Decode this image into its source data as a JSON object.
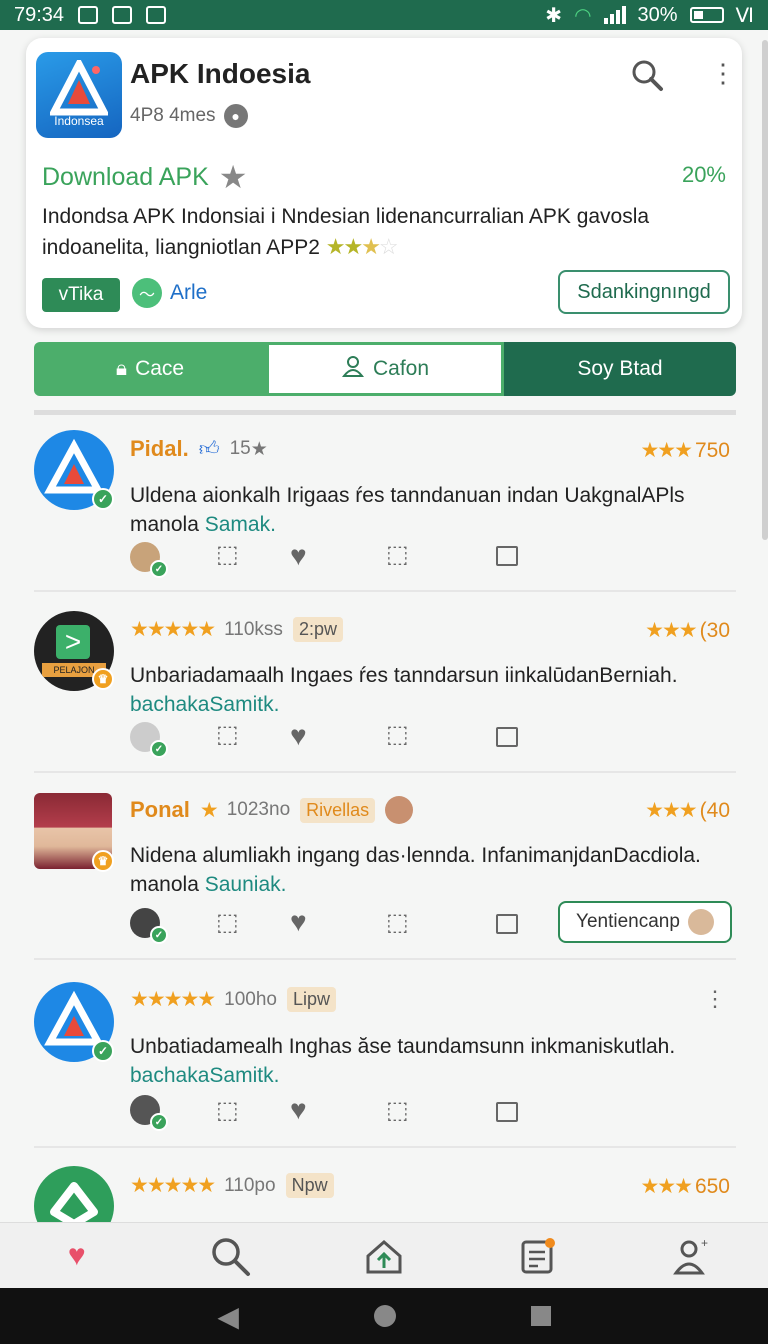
{
  "status_bar": {
    "time": "79:34",
    "battery": "30%",
    "extra": "Ⅵ"
  },
  "app": {
    "logo_text": "Indonsea",
    "title": "APK Indoesia",
    "subtitle": "4P8 4mes",
    "download_label": "Download APK",
    "download_pct": "20%",
    "description": "Indondsa APK Indonsiai i Nndesian lidenancurralian APK gavosla indoanelita, liangniotlan APP2",
    "tag_green": "vTika",
    "tag_arle": "Arle",
    "outline_button": "Sdankingnıngd"
  },
  "tabs": [
    {
      "label": "Cace"
    },
    {
      "label": "Cafon"
    },
    {
      "label": "Soy  Btad"
    }
  ],
  "reviews": [
    {
      "name": "Pidal.",
      "meta": "15",
      "rating": "750",
      "text": "Uldena aionkalh Irigaas ŕes tanndanuan indan UakgnalAPls manola",
      "link": "Samak."
    },
    {
      "meta": "110kss",
      "pill": "2:pw",
      "rating": "(30",
      "text": "Unbariadamaalh Ingaes ŕes tanndarsun iinkalūdanBerniah.",
      "link": "bachakaSamitk."
    },
    {
      "name": "Ponal",
      "meta": "1023no",
      "pill": "Rivellas",
      "rating": "(40",
      "text": "Nidena alumliakh ingang das·lennda. InfanimanjdanDacdiola. manola",
      "link": "Sauniak.",
      "reply": "Yentiencanp"
    },
    {
      "meta": "100ho",
      "pill": "Lipw",
      "text": "Unbatiadamealh Inghas ăse taundamsunn inkmaniskutlah.",
      "link": "bachakaSamitk."
    },
    {
      "meta": "110po",
      "pill": "Npw",
      "rating": "650"
    }
  ],
  "icons": {
    "search": "search-icon",
    "more": "more-vert-icon",
    "like": "thumbs-up-icon",
    "heart": "heart-icon",
    "share": "share-icon",
    "bookmark": "square-icon"
  },
  "colors": {
    "primary": "#1f6b4e",
    "accent": "#4cae6b",
    "star": "#f0a020",
    "name": "#e08a1c"
  }
}
